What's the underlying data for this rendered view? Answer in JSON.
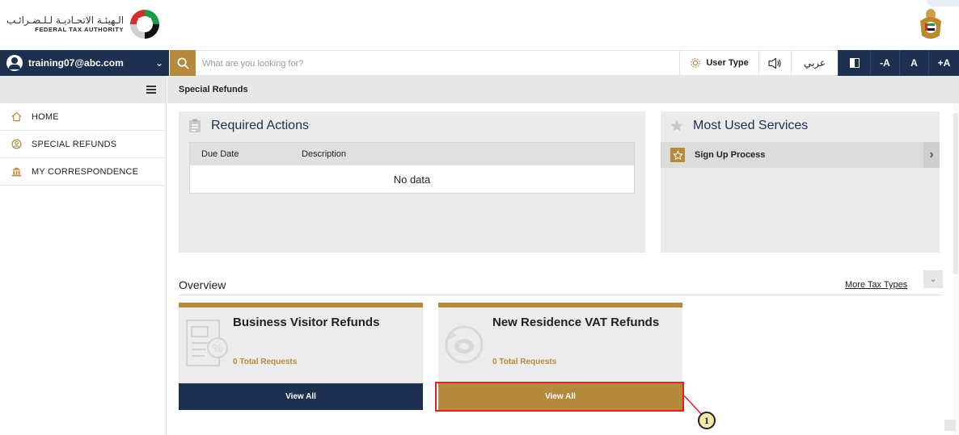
{
  "header": {
    "logo_arabic": "الـهيئـة الاتحـاديـة لـلـضـرائـب",
    "logo_english": "FEDERAL TAX AUTHORITY"
  },
  "topbar": {
    "account_email": "training07@abc.com",
    "search_placeholder": "What are you looking for?",
    "user_type_label": "User Type",
    "language_label": "عربي",
    "font_decrease": "-A",
    "font_normal": "A",
    "font_increase": "+A"
  },
  "sidebar": {
    "items": [
      {
        "label": "HOME",
        "icon": "home-icon"
      },
      {
        "label": "SPECIAL REFUNDS",
        "icon": "refund-icon"
      },
      {
        "label": "MY CORRESPONDENCE",
        "icon": "building-icon"
      }
    ]
  },
  "breadcrumb": "Special Refunds",
  "required_actions": {
    "title": "Required Actions",
    "columns": [
      "Due Date",
      "Description"
    ],
    "empty_text": "No data"
  },
  "most_used": {
    "title": "Most Used Services",
    "items": [
      {
        "label": "Sign Up Process"
      }
    ]
  },
  "overview": {
    "title": "Overview",
    "more_link": "More Tax Types",
    "cards": [
      {
        "title": "Business Visitor Refunds",
        "count": "0 Total Requests",
        "button": "View All"
      },
      {
        "title": "New Residence VAT Refunds",
        "count": "0 Total Requests",
        "button": "View All"
      }
    ]
  },
  "annotation": {
    "number": "1"
  },
  "colors": {
    "navy": "#1e3050",
    "gold": "#b58a3c",
    "highlight": "#e21f26"
  }
}
